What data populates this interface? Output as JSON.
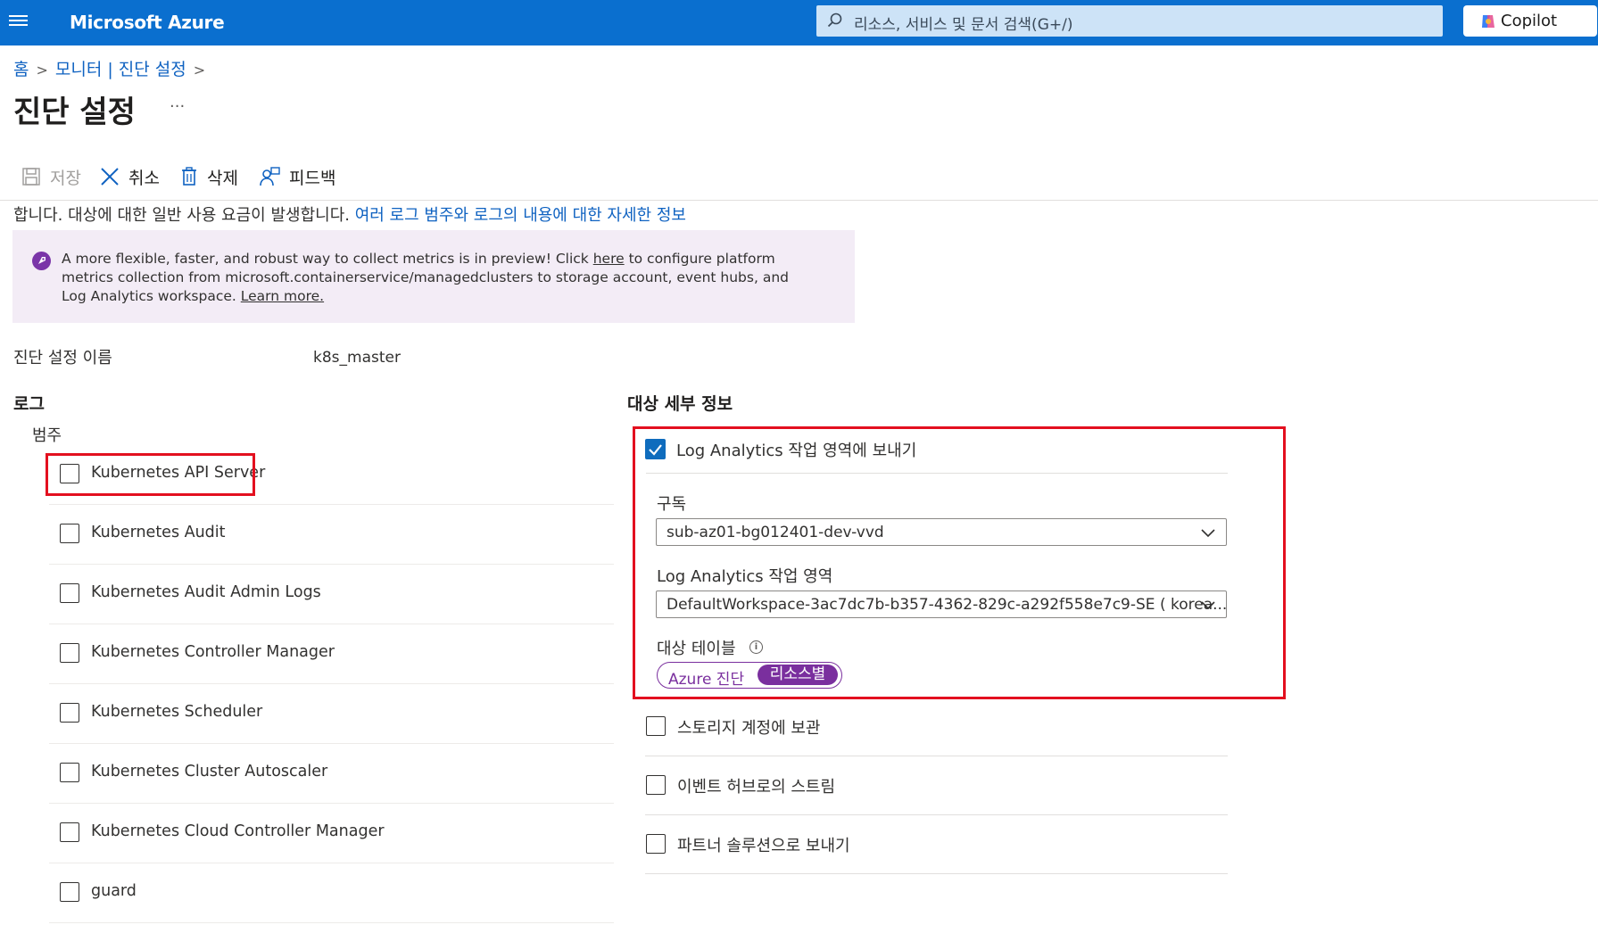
{
  "header": {
    "brand": "Microsoft Azure",
    "search_placeholder": "리소스, 서비스 및 문서 검색(G+/)",
    "copilot_label": "Copilot"
  },
  "breadcrumb": {
    "home": "홈",
    "parent": "모니터 | 진단 설정"
  },
  "page": {
    "title": "진단 설정",
    "more": "..."
  },
  "toolbar": {
    "save": "저장",
    "cancel": "취소",
    "delete": "삭제",
    "feedback": "피드백"
  },
  "description": {
    "text": "합니다. 대상에 대한 일반 사용 요금이 발생합니다. ",
    "link": "여러 로그 범주와 로그의 내용에 대한 자세한 정보"
  },
  "banner": {
    "part1": "A more flexible, faster, and robust way to collect metrics is in preview! Click ",
    "here": "here",
    "part2": " to configure platform metrics collection from microsoft.containerservice/managedclusters to storage account, event hubs, and Log Analytics workspace. ",
    "learn_more": "Learn more."
  },
  "setting_name": {
    "label": "진단 설정 이름",
    "value": "k8s_master"
  },
  "logs": {
    "heading": "로그",
    "category_label": "범주",
    "categories": [
      "Kubernetes API Server",
      "Kubernetes Audit",
      "Kubernetes Audit Admin Logs",
      "Kubernetes Controller Manager",
      "Kubernetes Scheduler",
      "Kubernetes Cluster Autoscaler",
      "Kubernetes Cloud Controller Manager",
      "guard"
    ]
  },
  "destination": {
    "heading": "대상 세부 정보",
    "log_analytics": {
      "label": "Log Analytics 작업 영역에 보내기",
      "checked": true,
      "subscription_label": "구독",
      "subscription_value": "sub-az01-bg012401-dev-vvd",
      "workspace_label": "Log Analytics 작업 영역",
      "workspace_value": "DefaultWorkspace-3ac7dc7b-b357-4362-829c-a292f558e7c9-SE ( korea...",
      "table_label": "대상 테이블",
      "table_option_azure": "Azure 진단",
      "table_option_resource": "리소스별",
      "table_selected": "리소스별"
    },
    "storage": "스토리지 계정에 보관",
    "event_hub": "이벤트 허브로의 스트림",
    "partner": "파트너 솔루션으로 보내기"
  },
  "colors": {
    "accent": "#0a6fcf",
    "highlight": "#e3101f",
    "pill": "#7a2f9e"
  }
}
